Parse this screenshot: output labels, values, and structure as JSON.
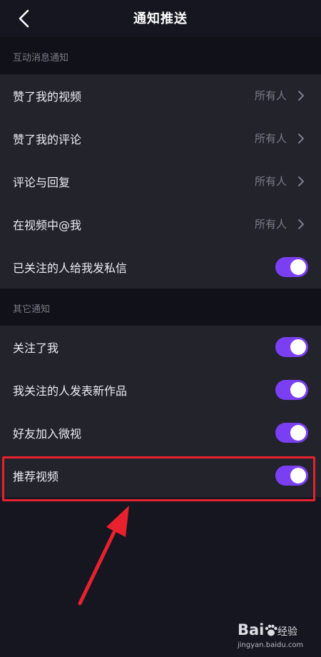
{
  "header": {
    "title": "通知推送",
    "back_icon": "chevron-left-icon"
  },
  "sections": [
    {
      "title": "互动消息通知",
      "rows": [
        {
          "label": "赞了我的视频",
          "value": "所有人"
        },
        {
          "label": "赞了我的评论",
          "value": "所有人"
        },
        {
          "label": "评论与回复",
          "value": "所有人"
        },
        {
          "label": "在视频中@我",
          "value": "所有人"
        },
        {
          "label": "已关注的人给我发私信",
          "toggle": true
        }
      ]
    },
    {
      "title": "其它通知",
      "rows": [
        {
          "label": "关注了我",
          "toggle": true
        },
        {
          "label": "我关注的人发表新作品",
          "toggle": true
        },
        {
          "label": "好友加入微视",
          "toggle": true
        },
        {
          "label": "推荐视频",
          "toggle": true
        }
      ]
    }
  ],
  "colors": {
    "toggle_on": "#7b3ff3",
    "highlight": "#e7222e",
    "background": "#161620",
    "row": "#23232c"
  },
  "watermark": {
    "logo": "Bai",
    "logo_suffix": "经验",
    "url": "jingyan.baidu.com"
  }
}
